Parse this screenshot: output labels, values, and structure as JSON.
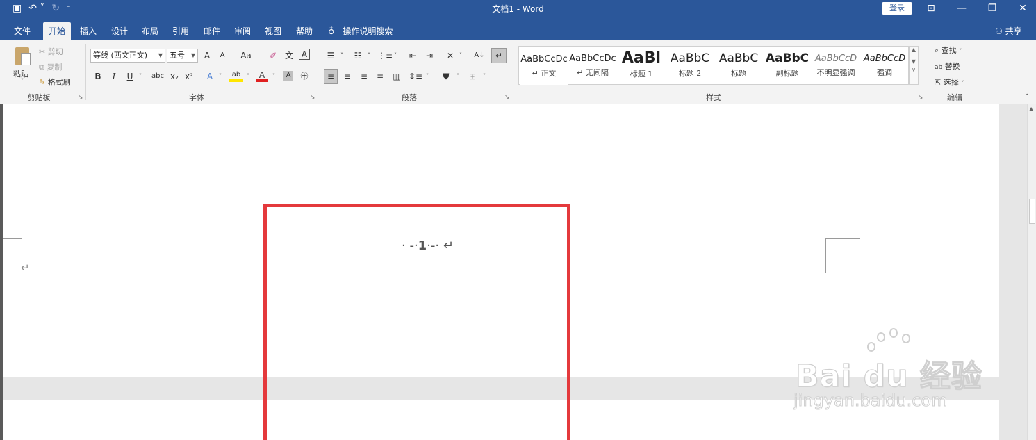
{
  "titlebar": {
    "title": "文档1 - Word",
    "login": "登录",
    "qat_icons": [
      "save-icon",
      "undo-icon",
      "redo-icon",
      "customize-icon"
    ],
    "controls": [
      "ribbon-display-icon",
      "minimize-icon",
      "restore-icon",
      "close-icon"
    ]
  },
  "tabs": {
    "items": [
      "文件",
      "开始",
      "插入",
      "设计",
      "布局",
      "引用",
      "邮件",
      "审阅",
      "视图",
      "帮助"
    ],
    "active": "开始",
    "tell_me": "操作说明搜索",
    "share": "共享"
  },
  "clipboard": {
    "label": "剪贴板",
    "paste": "粘贴",
    "cut": "剪切",
    "copy": "复制",
    "format_painter": "格式刷"
  },
  "font": {
    "label": "字体",
    "font_name": "等线 (西文正文)",
    "font_size": "五号",
    "grow": "A",
    "shrink": "A",
    "case": "Aa",
    "bold": "B",
    "italic": "I",
    "underline": "U",
    "strike": "abc",
    "subscript": "x₂",
    "superscript": "x²",
    "phonetic": "文",
    "border": "A",
    "text_effect": "A",
    "highlight": "ab",
    "font_color": "A",
    "shading": "A",
    "enclose": "字"
  },
  "paragraph": {
    "label": "段落",
    "sort": "A↓"
  },
  "styles": {
    "label": "样式",
    "items": [
      {
        "sample": "AaBbCcDc",
        "name": "↵ 正文"
      },
      {
        "sample": "AaBbCcDc",
        "name": "↵ 无间隔"
      },
      {
        "sample": "AaBl",
        "name": "标题 1"
      },
      {
        "sample": "AaBbC",
        "name": "标题 2"
      },
      {
        "sample": "AaBbC",
        "name": "标题"
      },
      {
        "sample": "AaBbC",
        "name": "副标题"
      },
      {
        "sample": "AaBbCcD",
        "name": "不明显强调"
      },
      {
        "sample": "AaBbCcD",
        "name": "强调"
      }
    ]
  },
  "editing": {
    "label": "编辑",
    "find": "查找",
    "replace": "替换",
    "select": "选择"
  },
  "document": {
    "page_number": "1",
    "header_left": "· -·",
    "header_right": "·-· ↵",
    "paragraph_mark": "↵"
  },
  "watermark": {
    "logo": "Bai du 经验",
    "url": "jingyan.baidu.com"
  },
  "colors": {
    "brand": "#2b579a",
    "highlight_box": "#e4393c"
  }
}
